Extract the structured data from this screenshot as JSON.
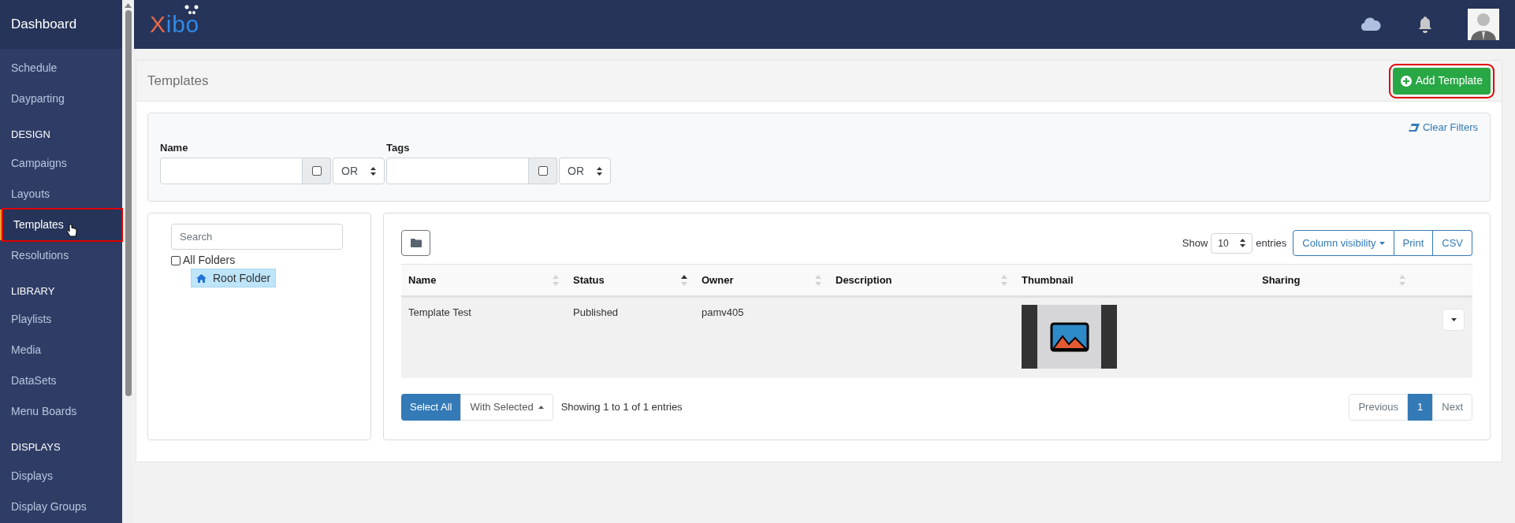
{
  "sidebar": {
    "header": "Dashboard",
    "sections": [
      {
        "items": [
          {
            "label": "Schedule",
            "selected": false,
            "highlighted": false
          },
          {
            "label": "Dayparting",
            "selected": false,
            "highlighted": false
          }
        ]
      },
      {
        "title": "DESIGN",
        "items": [
          {
            "label": "Campaigns",
            "selected": false,
            "highlighted": false
          },
          {
            "label": "Layouts",
            "selected": false,
            "highlighted": false
          },
          {
            "label": "Templates",
            "selected": true,
            "highlighted": true
          },
          {
            "label": "Resolutions",
            "selected": false,
            "highlighted": false
          }
        ]
      },
      {
        "title": "LIBRARY",
        "items": [
          {
            "label": "Playlists",
            "selected": false,
            "highlighted": false
          },
          {
            "label": "Media",
            "selected": false,
            "highlighted": false
          },
          {
            "label": "DataSets",
            "selected": false,
            "highlighted": false
          },
          {
            "label": "Menu Boards",
            "selected": false,
            "highlighted": false
          }
        ]
      },
      {
        "title": "DISPLAYS",
        "items": [
          {
            "label": "Displays",
            "selected": false,
            "highlighted": false
          },
          {
            "label": "Display Groups",
            "selected": false,
            "highlighted": false
          }
        ]
      }
    ]
  },
  "header": {
    "logo": "Xibo"
  },
  "page": {
    "title": "Templates",
    "add_button": {
      "label": "Add Template",
      "highlighted": true
    }
  },
  "filters": {
    "clear": "Clear Filters",
    "fields": [
      {
        "label": "Name",
        "checked": false,
        "operator": "OR"
      },
      {
        "label": "Tags",
        "checked": false,
        "operator": "OR"
      }
    ]
  },
  "folder_tree": {
    "search_placeholder": "Search",
    "all_folders": {
      "label": "All Folders",
      "checked": false
    },
    "folders": [
      {
        "label": "Root Folder",
        "selected": true
      }
    ]
  },
  "table": {
    "show_label": "Show",
    "page_size": "10",
    "entries_label": "entries",
    "buttons": [
      {
        "label": "Column visibility",
        "kind": "dropdown"
      },
      {
        "label": "Print",
        "kind": "plain"
      },
      {
        "label": "CSV",
        "kind": "plain"
      }
    ],
    "columns": [
      {
        "label": "Name",
        "sortable": true,
        "sorted": false
      },
      {
        "label": "Status",
        "sortable": true,
        "sorted": true
      },
      {
        "label": "Owner",
        "sortable": true,
        "sorted": false
      },
      {
        "label": "Description",
        "sortable": true,
        "sorted": false
      },
      {
        "label": "Thumbnail",
        "sortable": false
      },
      {
        "label": "Sharing",
        "sortable": true,
        "sorted": false
      }
    ],
    "rows": [
      {
        "name": "Template Test",
        "status": "Published",
        "owner": "pamv405",
        "thumbnail": true
      }
    ],
    "select_all": "Select All",
    "with_selected": "With Selected",
    "info": "Showing 1 to 1 of 1 entries",
    "pagination": [
      {
        "label": "Previous",
        "selected": false
      },
      {
        "label": "1",
        "selected": true
      },
      {
        "label": "Next",
        "selected": false
      }
    ]
  }
}
